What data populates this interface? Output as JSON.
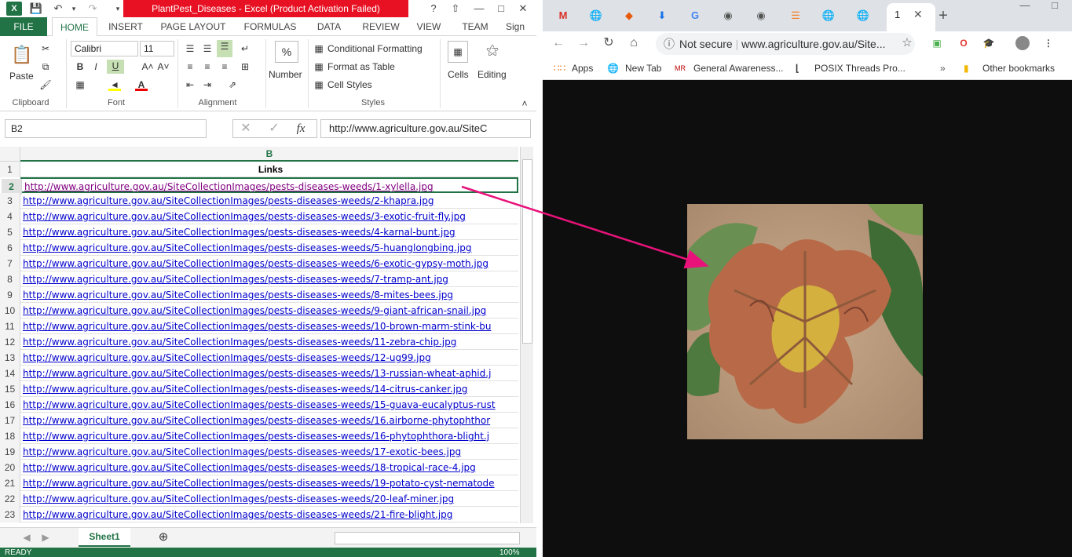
{
  "excel": {
    "title": "PlantPest_Diseases -  Excel (Product Activation Failed)",
    "help": "?",
    "tabs": [
      "FILE",
      "HOME",
      "INSERT",
      "PAGE LAYOUT",
      "FORMULAS",
      "DATA",
      "REVIEW",
      "VIEW",
      "TEAM",
      "Sign"
    ],
    "ribbon": {
      "paste": "Paste",
      "font_name": "Calibri",
      "font_size": "11",
      "number": "Number",
      "cond_format": "Conditional Formatting",
      "format_table": "Format as Table",
      "cell_styles": "Cell Styles",
      "cells": "Cells",
      "editing": "Editing",
      "groups": [
        "Clipboard",
        "Font",
        "Alignment",
        "Styles"
      ]
    },
    "name_box": "B2",
    "formula": "http://www.agriculture.gov.au/SiteC",
    "column_header": "B",
    "rows": [
      {
        "n": "1",
        "v": "Links"
      },
      {
        "n": "2",
        "v": "http://www.agriculture.gov.au/SiteCollectionImages/pests-diseases-weeds/1-xylella.jpg"
      },
      {
        "n": "3",
        "v": "http://www.agriculture.gov.au/SiteCollectionImages/pests-diseases-weeds/2-khapra.jpg"
      },
      {
        "n": "4",
        "v": "http://www.agriculture.gov.au/SiteCollectionImages/pests-diseases-weeds/3-exotic-fruit-fly.jpg"
      },
      {
        "n": "5",
        "v": "http://www.agriculture.gov.au/SiteCollectionImages/pests-diseases-weeds/4-karnal-bunt.jpg"
      },
      {
        "n": "6",
        "v": "http://www.agriculture.gov.au/SiteCollectionImages/pests-diseases-weeds/5-huanglongbing.jpg"
      },
      {
        "n": "7",
        "v": "http://www.agriculture.gov.au/SiteCollectionImages/pests-diseases-weeds/6-exotic-gypsy-moth.jpg"
      },
      {
        "n": "8",
        "v": "http://www.agriculture.gov.au/SiteCollectionImages/pests-diseases-weeds/7-tramp-ant.jpg"
      },
      {
        "n": "9",
        "v": "http://www.agriculture.gov.au/SiteCollectionImages/pests-diseases-weeds/8-mites-bees.jpg"
      },
      {
        "n": "10",
        "v": "http://www.agriculture.gov.au/SiteCollectionImages/pests-diseases-weeds/9-giant-african-snail.jpg"
      },
      {
        "n": "11",
        "v": "http://www.agriculture.gov.au/SiteCollectionImages/pests-diseases-weeds/10-brown-marm-stink-bu"
      },
      {
        "n": "12",
        "v": "http://www.agriculture.gov.au/SiteCollectionImages/pests-diseases-weeds/11-zebra-chip.jpg"
      },
      {
        "n": "13",
        "v": "http://www.agriculture.gov.au/SiteCollectionImages/pests-diseases-weeds/12-ug99.jpg"
      },
      {
        "n": "14",
        "v": "http://www.agriculture.gov.au/SiteCollectionImages/pests-diseases-weeds/13-russian-wheat-aphid.j"
      },
      {
        "n": "15",
        "v": "http://www.agriculture.gov.au/SiteCollectionImages/pests-diseases-weeds/14-citrus-canker.jpg"
      },
      {
        "n": "16",
        "v": "http://www.agriculture.gov.au/SiteCollectionImages/pests-diseases-weeds/15-guava-eucalyptus-rust"
      },
      {
        "n": "17",
        "v": "http://www.agriculture.gov.au/SiteCollectionImages/pests-diseases-weeds/16.airborne-phytophthor"
      },
      {
        "n": "18",
        "v": "http://www.agriculture.gov.au/SiteCollectionImages/pests-diseases-weeds/16-phytophthora-blight.j"
      },
      {
        "n": "19",
        "v": "http://www.agriculture.gov.au/SiteCollectionImages/pests-diseases-weeds/17-exotic-bees.jpg"
      },
      {
        "n": "20",
        "v": "http://www.agriculture.gov.au/SiteCollectionImages/pests-diseases-weeds/18-tropical-race-4.jpg"
      },
      {
        "n": "21",
        "v": "http://www.agriculture.gov.au/SiteCollectionImages/pests-diseases-weeds/19-potato-cyst-nematode"
      },
      {
        "n": "22",
        "v": "http://www.agriculture.gov.au/SiteCollectionImages/pests-diseases-weeds/20-leaf-miner.jpg"
      },
      {
        "n": "23",
        "v": "http://www.agriculture.gov.au/SiteCollectionImages/pests-diseases-weeds/21-fire-blight.jpg"
      }
    ],
    "sheet_tab": "Sheet1",
    "status": "READY",
    "zoom": "100%"
  },
  "chrome": {
    "active_tab_label": "1",
    "url": "www.agriculture.gov.au/Site...",
    "security": "Not secure",
    "bookmarks": [
      "Apps",
      "New Tab",
      "General Awareness...",
      "POSIX Threads Pro...",
      "Other bookmarks"
    ]
  },
  "colors": {
    "excel_green": "#217346",
    "activation_red": "#e81123",
    "arrow": "#e8127a",
    "link": "#0000cc",
    "visited": "#800080"
  }
}
